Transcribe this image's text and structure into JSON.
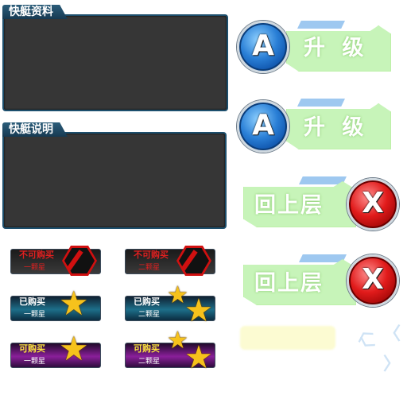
{
  "panels": {
    "info_title": "快艇资料",
    "desc_title": "快艇说明"
  },
  "buttons": {
    "upgrade1": {
      "icon": "A",
      "label": "升 级"
    },
    "upgrade2": {
      "icon": "A",
      "label": "升 级"
    },
    "back1": {
      "icon": "X",
      "label": "回上层"
    },
    "back2": {
      "icon": "X",
      "label": "回上层"
    }
  },
  "badges": {
    "b1": {
      "title": "不可购买",
      "sub": "一颗星"
    },
    "b2": {
      "title": "不可购买",
      "sub": "二颗星"
    },
    "b3": {
      "title": "已购买",
      "sub": "一颗星"
    },
    "b4": {
      "title": "已购买",
      "sub": "二颗星"
    },
    "b5": {
      "title": "可购买",
      "sub": "一颗星"
    },
    "b6": {
      "title": "可购买",
      "sub": "二颗星"
    }
  },
  "colors": {
    "panel_border": "#1d4f6d",
    "panel_fill": "#363636",
    "green_plate": "#c7f4b9",
    "not_buyable_text": "#e02020",
    "bought_text": "#ffffff",
    "buyable_text": "#ffe640"
  },
  "icons": [
    "lock-hex-icon",
    "star-icon",
    "chevron-icon"
  ]
}
